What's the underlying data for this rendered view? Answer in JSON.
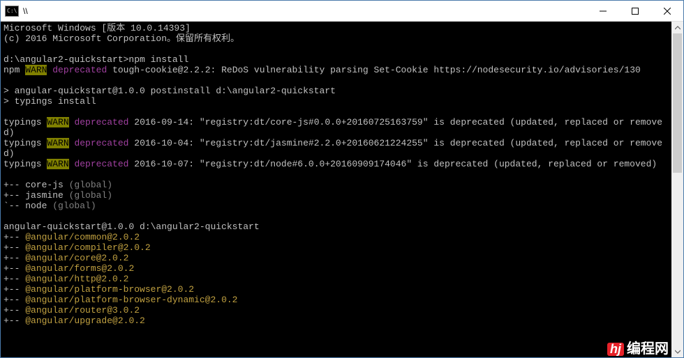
{
  "titlebar": {
    "icon_label": "C:\\",
    "title": "\\\\"
  },
  "terminal": {
    "header_line1": "Microsoft Windows [版本 10.0.14393]",
    "header_line2": "(c) 2016 Microsoft Corporation。保留所有权利。",
    "prompt1": "d:\\angular2-quickstart>npm install",
    "npm_prefix": "npm ",
    "warn_badge": "WARN",
    "deprecated_word": " deprecated",
    "npm_warn_rest": " tough-cookie@2.2.2: ReDoS vulnerability parsing Set-Cookie https://nodesecurity.io/advisories/130",
    "postinstall_line": "> angular-quickstart@1.0.0 postinstall d:\\angular2-quickstart",
    "typings_install": "> typings install",
    "typings_prefix": "typings ",
    "typ_warn1_rest": " 2016-09-14: \"registry:dt/core-js#0.0.0+20160725163759\" is deprecated (updated, replaced or removed)",
    "typ_warn2_rest": " 2016-10-04: \"registry:dt/jasmine#2.2.0+20160621224255\" is deprecated (updated, replaced or removed)",
    "typ_warn3_rest": " 2016-10-07: \"registry:dt/node#6.0.0+20160909174046\" is deprecated (updated, replaced or removed)",
    "tree_corejs_a": "+-- core-js ",
    "tree_global": "(global)",
    "tree_jasmine_a": "+-- jasmine ",
    "tree_node_a": "`-- node ",
    "pkg_root": "angular-quickstart@1.0.0 d:\\angular2-quickstart",
    "pkg_tree_prefix_mid": "+-- ",
    "pkg_common": "@angular/common@2.0.2",
    "pkg_compiler": "@angular/compiler@2.0.2",
    "pkg_core": "@angular/core@2.0.2",
    "pkg_forms": "@angular/forms@2.0.2",
    "pkg_http": "@angular/http@2.0.2",
    "pkg_pbrowser": "@angular/platform-browser@2.0.2",
    "pkg_pbrowserdyn": "@angular/platform-browser-dynamic@2.0.2",
    "pkg_router": "@angular/router@3.0.2",
    "pkg_upgrade": "@angular/upgrade@2.0.2"
  },
  "watermark": {
    "badge": "hj",
    "text": "编程网"
  }
}
